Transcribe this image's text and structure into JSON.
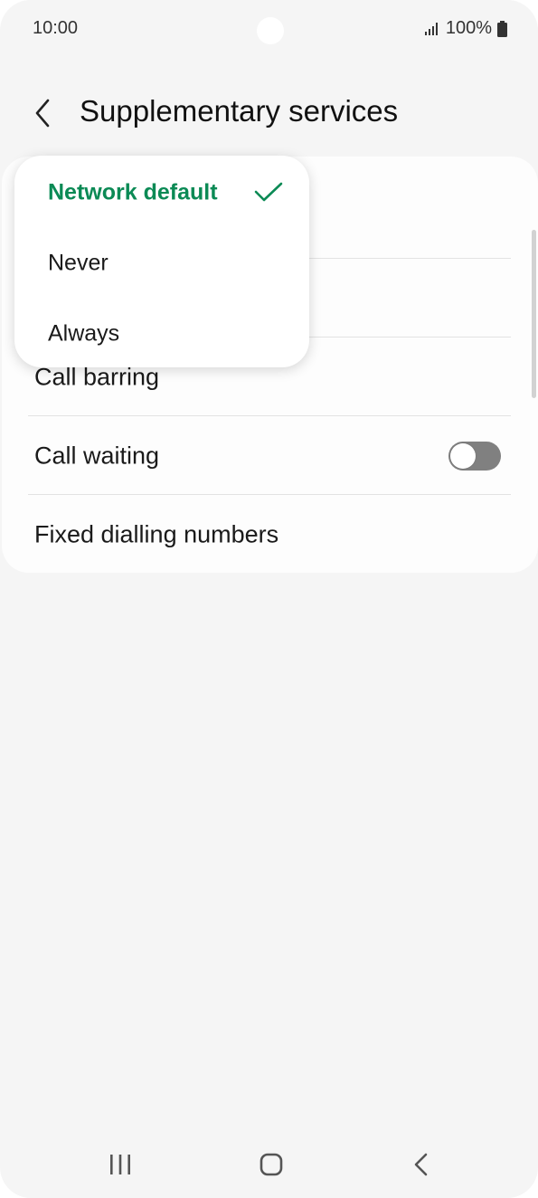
{
  "status_bar": {
    "time": "10:00",
    "battery": "100%",
    "icons": [
      "signal-icon",
      "battery-icon"
    ]
  },
  "header": {
    "back_icon": "back-arrow-icon",
    "title": "Supplementary services"
  },
  "settings": {
    "rows": [
      {
        "label": "Call barring"
      },
      {
        "label": "Call waiting",
        "toggle_on": false
      },
      {
        "label": "Fixed dialling numbers"
      }
    ]
  },
  "dropdown": {
    "options": [
      {
        "label": "Network default",
        "selected": true
      },
      {
        "label": "Never",
        "selected": false
      },
      {
        "label": "Always",
        "selected": false
      }
    ]
  },
  "nav_bar": {
    "icons": [
      "recent-apps-icon",
      "home-icon",
      "back-icon"
    ]
  },
  "colors": {
    "accent": "#0b8a55",
    "background": "#f5f5f5",
    "card": "#fdfdfd",
    "toggle_off": "#808080"
  }
}
